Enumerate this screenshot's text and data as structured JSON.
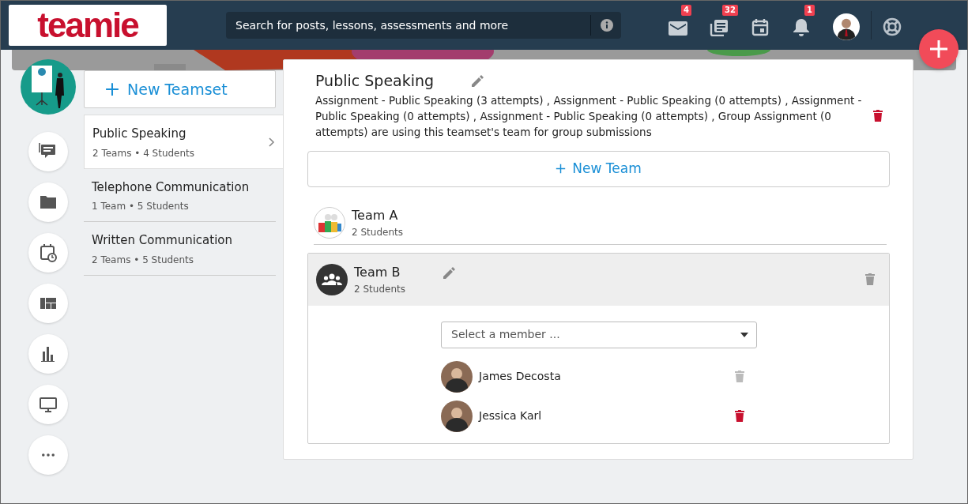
{
  "header": {
    "logo": "teamie",
    "search": {
      "placeholder": "Search for posts, lessons, assessments and more"
    },
    "badges": {
      "messages": "4",
      "feed": "32",
      "notifications": "1"
    }
  },
  "new_teamset": {
    "label": "New Teamset"
  },
  "teamsets": [
    {
      "name": "Public Speaking",
      "meta": "2 Teams • 4 Students",
      "selected": true
    },
    {
      "name": "Telephone Communication",
      "meta": "1 Team • 5 Students",
      "selected": false
    },
    {
      "name": "Written Communication",
      "meta": "2 Teams • 5 Students",
      "selected": false
    }
  ],
  "detail": {
    "title": "Public Speaking",
    "usage": "Assignment - Public Speaking (3 attempts) , Assignment - Public Speaking (0 attempts) , Assignment - Public Speaking (0 attempts) , Assignment - Public Speaking (0 attempts) , Group Assignment (0 attempts) are using this teamset's team for group submissions",
    "new_team": {
      "label": "New Team"
    },
    "teams": [
      {
        "name": "Team A",
        "meta": "2 Students",
        "expanded": false,
        "kind": "picture"
      },
      {
        "name": "Team B",
        "meta": "2 Students",
        "expanded": true,
        "kind": "group",
        "select": {
          "placeholder": "Select a member ..."
        },
        "members": [
          {
            "name": "James Decosta",
            "hovered": false
          },
          {
            "name": "Jessica Karl",
            "hovered": true
          }
        ]
      }
    ]
  }
}
